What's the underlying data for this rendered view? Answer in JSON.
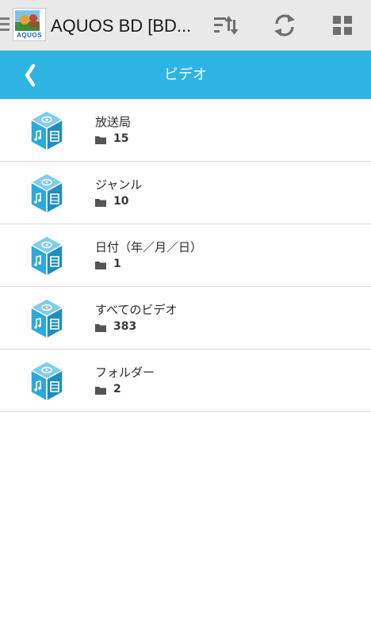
{
  "app_bar": {
    "app_name": "AQUOS BD [BD...",
    "logo_text": "AQUOS",
    "actions": [
      {
        "icon": "sort-icon"
      },
      {
        "icon": "refresh-icon"
      },
      {
        "icon": "grid-view-icon"
      }
    ],
    "background_color": "#e9e9e9"
  },
  "sub_bar": {
    "title": "ビデオ",
    "back_icon": "chevron-left-icon",
    "background_color": "#2db4e3"
  },
  "list": {
    "item_icon": "media-cube-icon",
    "count_icon": "folder-icon",
    "items": [
      {
        "title": "放送局",
        "count": "15"
      },
      {
        "title": "ジャンル",
        "count": "10"
      },
      {
        "title": "日付（年／月／日）",
        "count": "1"
      },
      {
        "title": "すべてのビデオ",
        "count": "383"
      },
      {
        "title": "フォルダー",
        "count": "2"
      }
    ]
  }
}
